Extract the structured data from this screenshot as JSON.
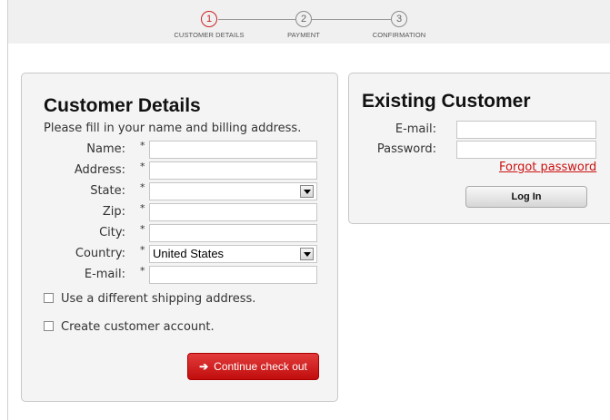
{
  "steps": [
    {
      "number": "1",
      "label": "CUSTOMER DETAILS",
      "active": true
    },
    {
      "number": "2",
      "label": "PAYMENT",
      "active": false
    },
    {
      "number": "3",
      "label": "CONFIRMATION",
      "active": false
    }
  ],
  "customer": {
    "title": "Customer Details",
    "intro": "Please fill in your name and billing address.",
    "required_mark": "*",
    "fields": {
      "name": {
        "label": "Name:",
        "value": ""
      },
      "address": {
        "label": "Address:",
        "value": ""
      },
      "state": {
        "label": "State:",
        "value": ""
      },
      "zip": {
        "label": "Zip:",
        "value": ""
      },
      "city": {
        "label": "City:",
        "value": ""
      },
      "country": {
        "label": "Country:",
        "value": "United States"
      },
      "email": {
        "label": "E-mail:",
        "value": ""
      }
    },
    "shipping_checkbox": "Use a different shipping address.",
    "account_checkbox": "Create customer account.",
    "continue_button": "Continue check out",
    "continue_arrow": "➔"
  },
  "existing": {
    "title": "Existing Customer",
    "email_label": "E-mail:",
    "email_value": "",
    "password_label": "Password:",
    "password_value": "",
    "forgot_link": "Forgot password",
    "login_button": "Log In"
  },
  "colors": {
    "accent": "#cc2222",
    "button_red": "#c10d0d",
    "panel_bg": "#f4f4f4"
  }
}
